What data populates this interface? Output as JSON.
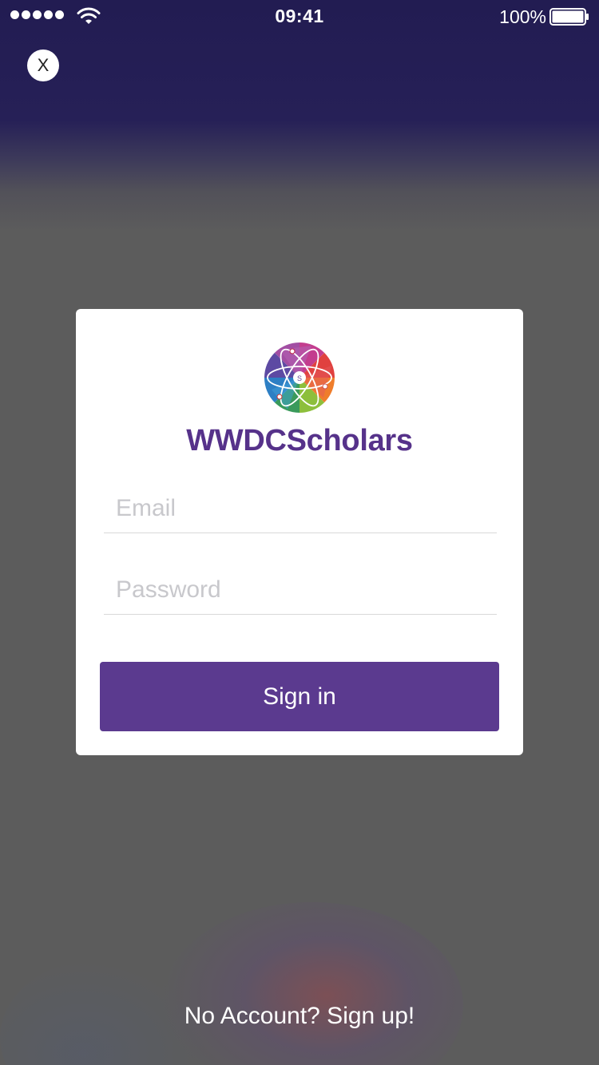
{
  "status_bar": {
    "time": "09:41",
    "battery_percent": "100%",
    "signal_icon": "signal-dots-icon",
    "wifi_icon": "wifi-icon",
    "battery_icon": "battery-icon",
    "battery_level": 1.0
  },
  "close_button": {
    "label": "X",
    "icon": "close-icon"
  },
  "login_card": {
    "logo_icon": "wwdc-scholars-atom-logo",
    "title": "WWDCScholars",
    "email": {
      "placeholder": "Email",
      "value": ""
    },
    "password": {
      "placeholder": "Password",
      "value": ""
    },
    "signin_label": "Sign in"
  },
  "signup_link": "No Account? Sign up!",
  "colors": {
    "brand_purple": "#56328a",
    "button_purple": "#5b3a8f",
    "header_navy": "#221c52",
    "background_gray": "#5c5c5c",
    "card_white": "#ffffff"
  }
}
